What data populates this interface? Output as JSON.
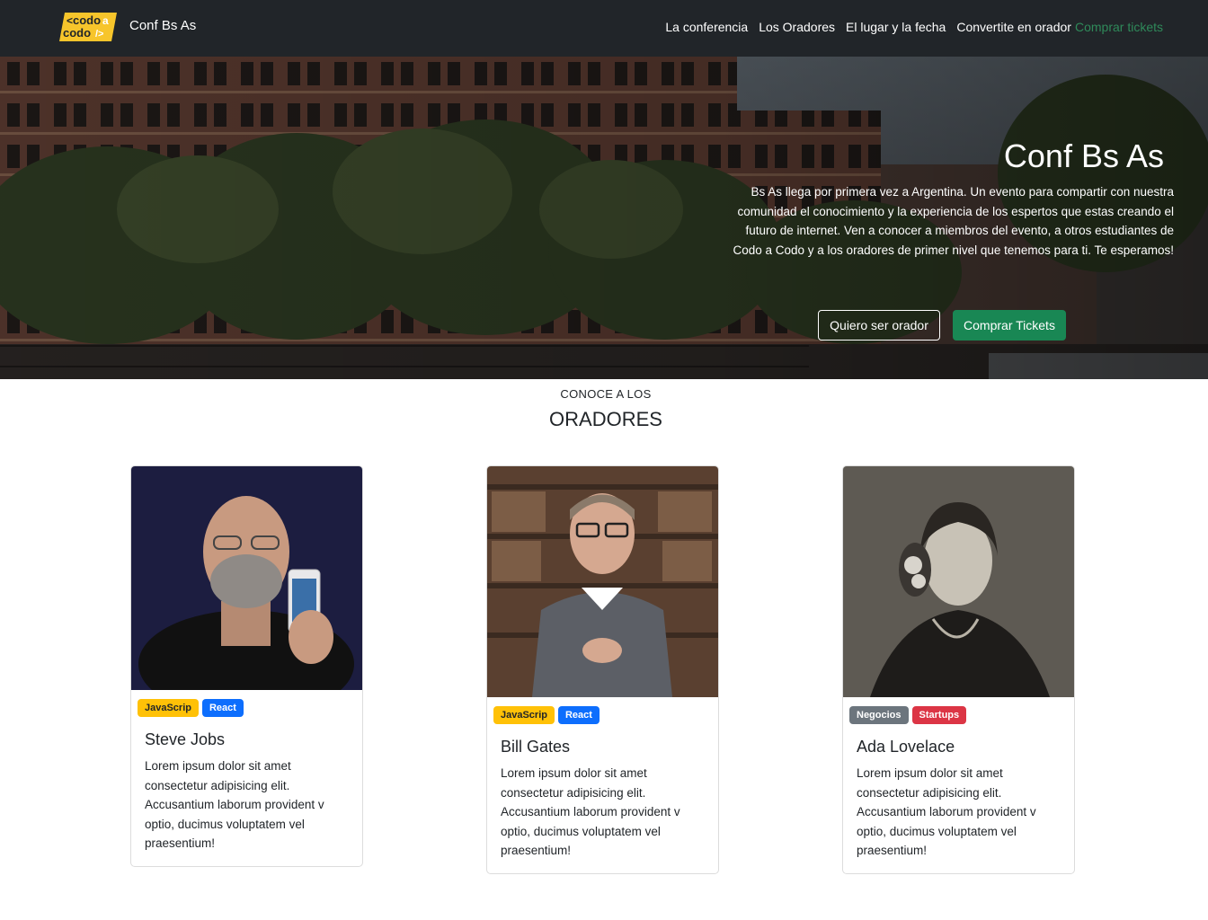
{
  "nav": {
    "logo_text_top": "codo",
    "logo_text_bottom": "codo",
    "logo_accent": "a",
    "brand": "Conf Bs As",
    "links": [
      "La conferencia",
      "Los Oradores",
      "El lugar y la fecha",
      "Convertite en orador"
    ],
    "tickets": "Comprar tickets"
  },
  "hero": {
    "title": "Conf Bs As",
    "description": "Bs As llega por primera vez a Argentina. Un evento para compartir con nuestra comunidad el conocimiento y la experiencia de los espertos que estas creando el futuro de internet. Ven a conocer a miembros del evento, a otros estudiantes de Codo a Codo y a los oradores de primer nivel que tenemos para ti. Te esperamos!",
    "btn_speaker": "Quiero ser orador",
    "btn_tickets": "Comprar Tickets"
  },
  "speakers": {
    "subtitle": "CONOCE A LOS",
    "title": "ORADORES",
    "cards": [
      {
        "name": "Steve Jobs",
        "badges": [
          {
            "label": "JavaScrip",
            "color": "yellow"
          },
          {
            "label": "React",
            "color": "blue"
          }
        ],
        "text": "Lorem ipsum dolor sit amet consectetur adipisicing elit. Accusantium laborum provident v optio, ducimus voluptatem vel praesentium!"
      },
      {
        "name": "Bill Gates",
        "badges": [
          {
            "label": "JavaScrip",
            "color": "yellow"
          },
          {
            "label": "React",
            "color": "blue"
          }
        ],
        "text": "Lorem ipsum dolor sit amet consectetur adipisicing elit. Accusantium laborum provident v optio, ducimus voluptatem vel praesentium!"
      },
      {
        "name": "Ada Lovelace",
        "badges": [
          {
            "label": "Negocios",
            "color": "gray"
          },
          {
            "label": "Startups",
            "color": "red"
          }
        ],
        "text": "Lorem ipsum dolor sit amet consectetur adipisicing elit. Accusantium laborum provident v optio, ducimus voluptatem vel praesentium!"
      }
    ]
  },
  "colors": {
    "navbar": "#212529",
    "accent_green": "#198754",
    "tickets_link": "#2f8a5a",
    "logo_yellow": "#f7c52b"
  }
}
